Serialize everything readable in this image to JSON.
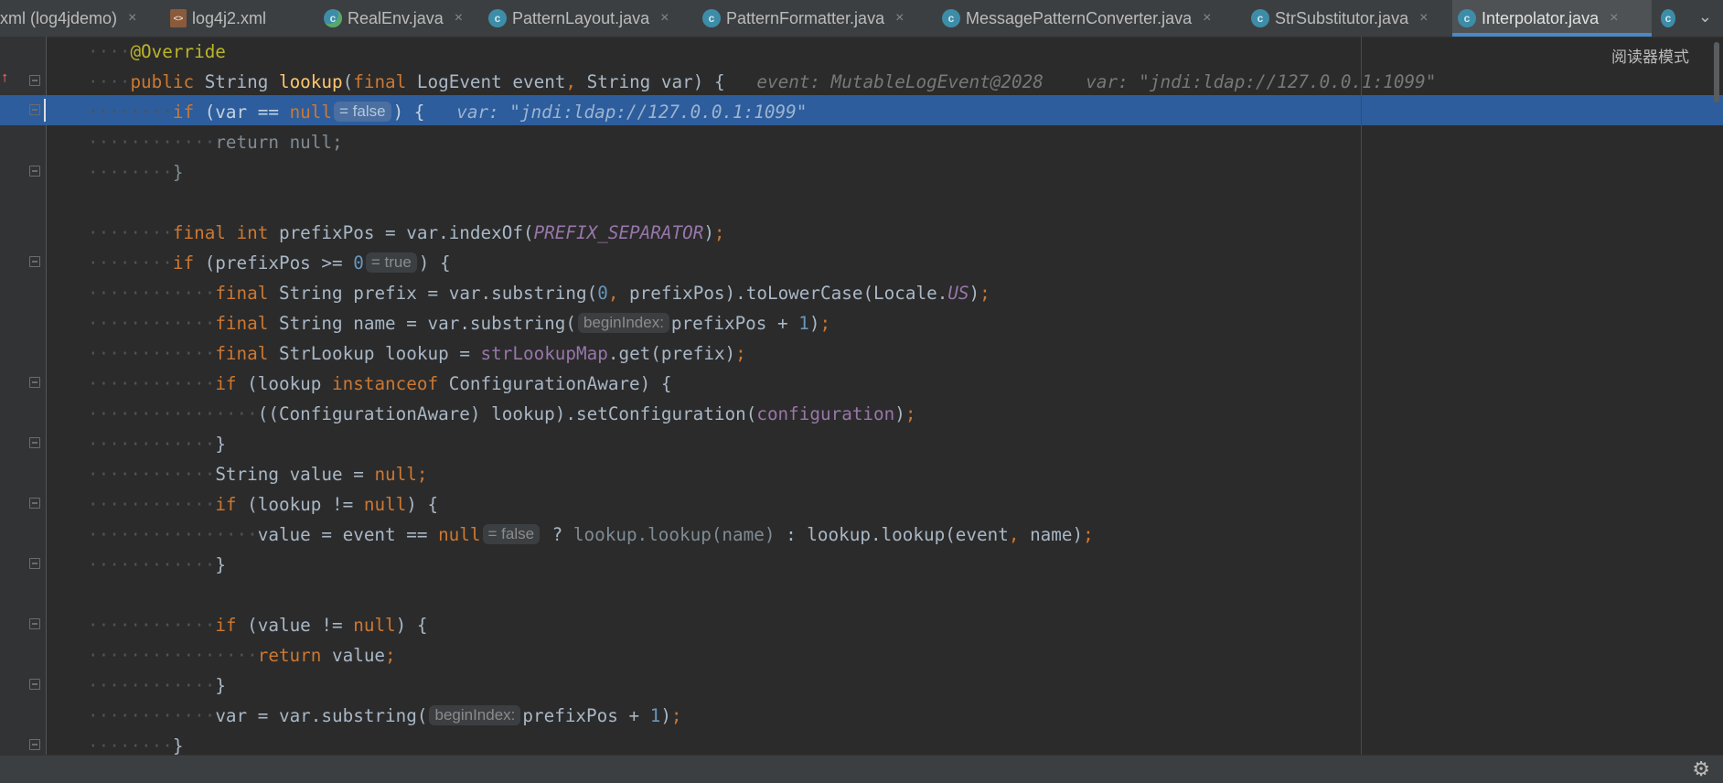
{
  "tabs": [
    {
      "label": "xml (log4jdemo)",
      "icon": "none",
      "active": false
    },
    {
      "label": "log4j2.xml",
      "icon": "xml-file-icon",
      "active": false
    },
    {
      "label": "RealEnv.java",
      "icon": "java-class-icon",
      "active": false
    },
    {
      "label": "PatternLayout.java",
      "icon": "java-class-icon",
      "active": false
    },
    {
      "label": "PatternFormatter.java",
      "icon": "java-class-icon",
      "active": false
    },
    {
      "label": "MessagePatternConverter.java",
      "icon": "java-class-icon",
      "active": false
    },
    {
      "label": "StrSubstitutor.java",
      "icon": "java-class-icon",
      "active": false
    },
    {
      "label": "Interpolator.java",
      "icon": "java-class-icon",
      "active": true
    }
  ],
  "close_glyph": "×",
  "chevron_glyph": "⌄",
  "reader_mode_label": "阅读器模式",
  "hints": {
    "eq_false": "= false",
    "eq_true": "= true",
    "begin_index": "beginIndex:"
  },
  "inline_values": {
    "method_event": "event: MutableLogEvent@2028",
    "method_var": "var: \"jndi:ldap://127.0.0.1:1099\"",
    "if_var": "var: \"jndi:ldap://127.0.0.1:1099\""
  },
  "code_text": {
    "annotation": "@Override",
    "kw_public": "public",
    "kw_final": "final",
    "kw_int": "int",
    "kw_if": "if",
    "kw_return": "return",
    "kw_null": "null",
    "kw_instanceof": "instanceof",
    "t_string": "String",
    "t_logevent": "LogEvent",
    "t_strlookup": "StrLookup",
    "t_configaware": "ConfigurationAware",
    "fn_lookup": "lookup",
    "const_prefix_sep": "PREFIX_SEPARATOR",
    "const_us": "US",
    "field_map": "strLookupMap",
    "field_config": "configuration",
    "num_0": "0",
    "num_1": "1"
  },
  "colors": {
    "background": "#2b2b2b",
    "keyword": "#cc7832",
    "function": "#ffc66d",
    "number": "#6897bb",
    "field": "#9876aa",
    "annotation": "#bbb529",
    "selection": "#2d5d9c",
    "active_tab_underline": "#4a88c7"
  },
  "status": {
    "settings_icon": "gear-icon"
  }
}
